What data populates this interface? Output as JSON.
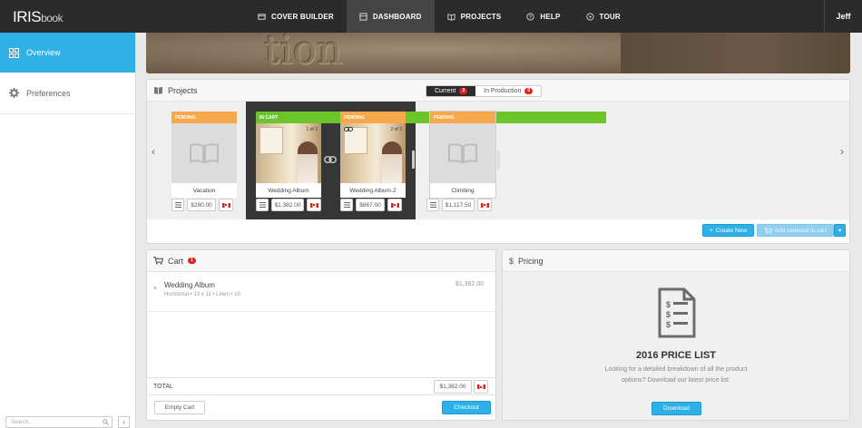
{
  "app": {
    "logo_main": "IRIS",
    "logo_sub": "book",
    "user": "Jeff"
  },
  "nav": [
    {
      "label": "COVER BUILDER",
      "icon": "book-icon"
    },
    {
      "label": "DASHBOARD",
      "icon": "dashboard-icon"
    },
    {
      "label": "PROJECTS",
      "icon": "open-book-icon"
    },
    {
      "label": "HELP",
      "icon": "question-icon"
    },
    {
      "label": "TOUR",
      "icon": "compass-icon"
    }
  ],
  "sidebar": {
    "items": [
      {
        "label": "Overview",
        "icon": "grid-icon"
      },
      {
        "label": "Preferences",
        "icon": "gear-icon"
      }
    ],
    "search_placeholder": "Search..."
  },
  "banner": {
    "emboss_text": "tion"
  },
  "projects": {
    "title": "Projects",
    "tabs": [
      {
        "label": "Current",
        "count": "3"
      },
      {
        "label": "In Production",
        "count": "0"
      }
    ],
    "cards": [
      {
        "status": "PENDING",
        "name": "Vacation",
        "price": "$280.00"
      },
      {
        "status": "IN CART",
        "name": "Wedding Album",
        "price": "$1,382.00",
        "pages": "1 of 2"
      },
      {
        "status": "PENDING",
        "name": "Wedding Album-2",
        "price": "$867.00",
        "pages": "2 of 2"
      },
      {
        "status": "PENDING",
        "name": "Climbing",
        "price": "$1,117.50"
      }
    ],
    "create_new": "Create New",
    "add_selected": "Add selected to cart"
  },
  "cart": {
    "title": "Cart",
    "count": "1",
    "item": {
      "name": "Wedding Album",
      "details": "Horizontal • 13 x 11 • Linen • 10",
      "price": "$1,382.00"
    },
    "total_label": "TOTAL",
    "total_value": "$1,382.00",
    "empty_label": "Empty Cart",
    "checkout_label": "Checkout"
  },
  "pricing": {
    "title": "Pricing",
    "heading": "2016 PRICE LIST",
    "desc_line1": "Looking for a detailed breakdown of all the product",
    "desc_line2": "options? Download our latest price list.",
    "download_label": "Download"
  },
  "colors": {
    "accent": "#2fb1e7",
    "pending": "#f7a84a",
    "in_cart": "#6cc42b",
    "badge": "#e0231c",
    "topbar": "#2b2b2b"
  }
}
